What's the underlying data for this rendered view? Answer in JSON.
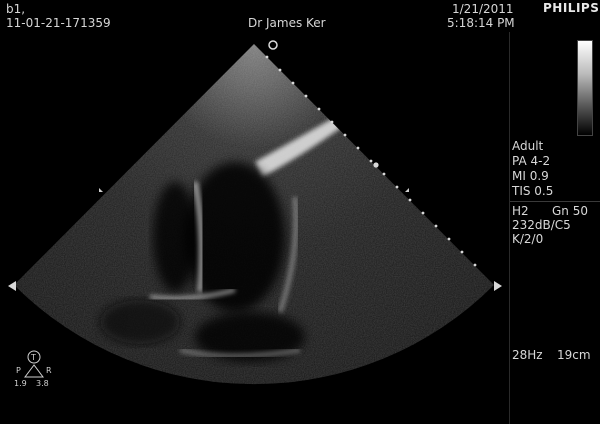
{
  "header": {
    "study_line1": "b1,",
    "study_line2": "11-01-21-171359",
    "physician": "Dr James Ker",
    "date": "1/21/2011",
    "time": "5:18:14 PM",
    "brand": "PHILIPS"
  },
  "panel": {
    "patient_type": "Adult",
    "probe": "PA 4-2",
    "mi": "MI 0.9",
    "tis": "TIS 0.5",
    "harmonic": "H2",
    "gain": "Gn 50",
    "dynamic_range": "232dB/C5",
    "settings": "K/2/0",
    "frame_rate": "28Hz",
    "depth": "19cm"
  },
  "orientation": {
    "top": "T",
    "left": "P",
    "right": "R",
    "left_value": "1.9",
    "right_value": "3.8"
  },
  "colors": {
    "background": "#000000",
    "text": "#d6d6d6",
    "sector_base": "#1a1a1a"
  }
}
